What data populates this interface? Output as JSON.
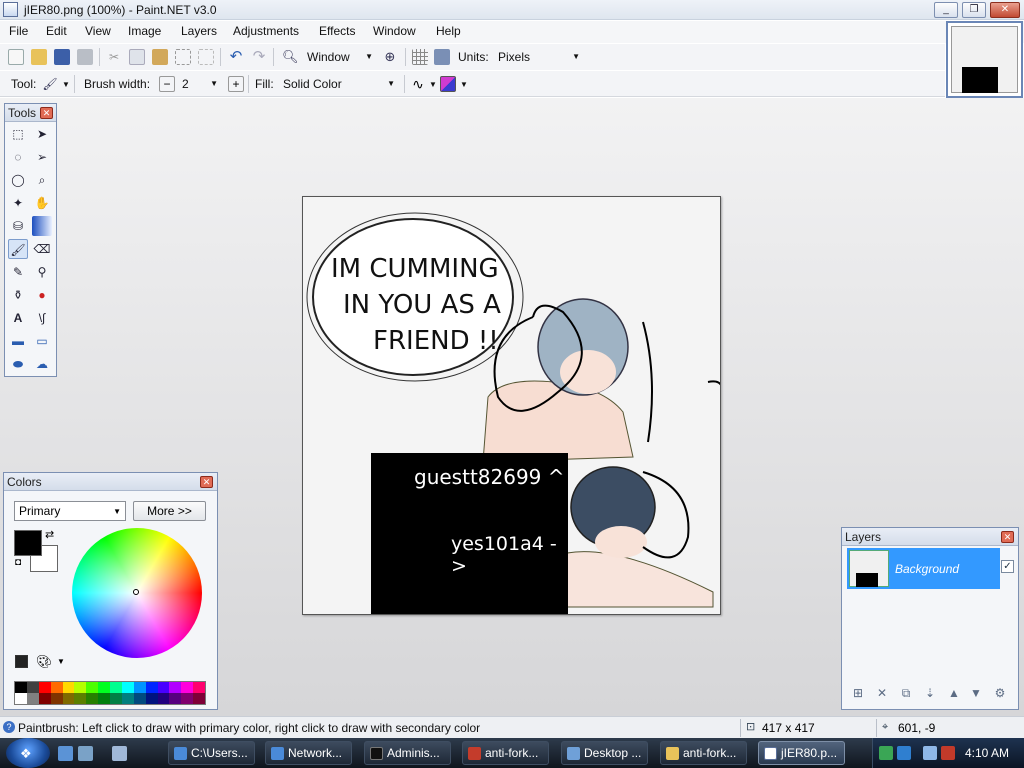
{
  "window": {
    "title": "jIER80.png (100%) - Paint.NET v3.0"
  },
  "menu": [
    "File",
    "Edit",
    "View",
    "Image",
    "Layers",
    "Adjustments",
    "Effects",
    "Window",
    "Help"
  ],
  "toolbar": {
    "window_label": "Window",
    "units_label": "Units:",
    "units_value": "Pixels",
    "tool_label": "Tool:",
    "brush_width_label": "Brush width:",
    "brush_width_value": "2",
    "fill_label": "Fill:",
    "fill_value": "Solid Color"
  },
  "tools_window": {
    "title": "Tools"
  },
  "canvas": {
    "speech_bubble_lines": [
      "IM CUMMING",
      "IN YOU AS A",
      "FRIEND !!"
    ],
    "overlay_line1": "guestt82699 ^",
    "overlay_line2": "yes101a4 ->"
  },
  "colors_window": {
    "title": "Colors",
    "mode_select": "Primary",
    "more_button": "More >>",
    "primary_color": "#000000",
    "secondary_color": "#ffffff",
    "palette": [
      "#000000",
      "#404040",
      "#ff0000",
      "#ff6a00",
      "#ffd800",
      "#b6ff00",
      "#4cff00",
      "#00ff21",
      "#00ff90",
      "#00ffff",
      "#0094ff",
      "#0026ff",
      "#4800ff",
      "#b200ff",
      "#ff00dc",
      "#ff006e",
      "#ffffff",
      "#808080",
      "#7f0000",
      "#7f3300",
      "#7f6a00",
      "#5b7f00",
      "#267f00",
      "#007f0e",
      "#007f46",
      "#007f7f",
      "#004a7f",
      "#00137f",
      "#21007f",
      "#57007f",
      "#7f006e",
      "#7f0037"
    ]
  },
  "layers_window": {
    "title": "Layers",
    "layers": [
      {
        "name": "Background",
        "visible": true
      }
    ]
  },
  "status": {
    "hint": "Paintbrush: Left click to draw with primary color, right click to draw with secondary color",
    "image_size": "417 x 417",
    "cursor_pos": "601, -9"
  },
  "taskbar": {
    "tasks": [
      "C:\\Users...",
      "Network...",
      "Adminis...",
      "anti-fork...",
      "Desktop ...",
      "anti-fork...",
      "jIER80.p..."
    ],
    "clock": "4:10 AM"
  }
}
